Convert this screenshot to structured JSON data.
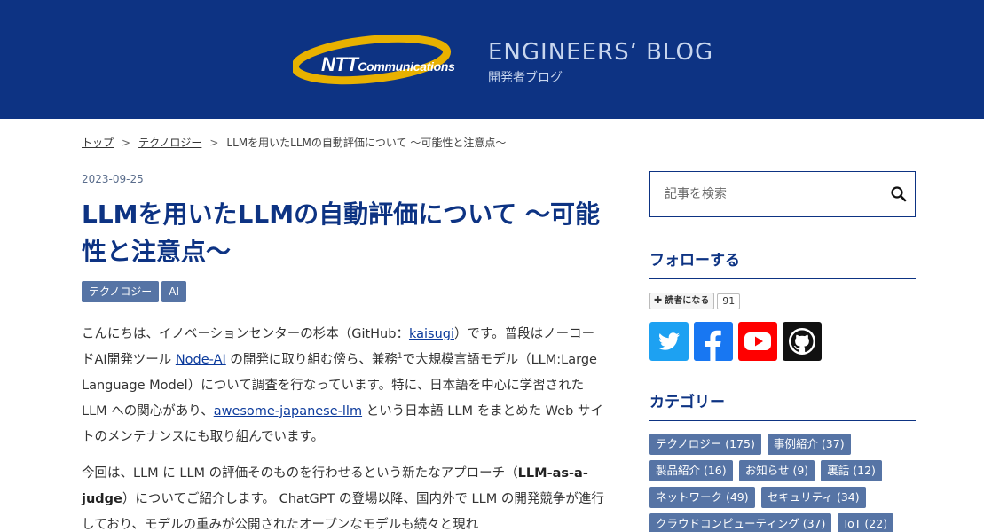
{
  "header": {
    "logo_ntt": "NTT",
    "logo_company": "Communications",
    "blog_title": "ENGINEERS’ BLOG",
    "blog_subtitle": "開発者ブログ"
  },
  "breadcrumb": {
    "items": [
      "トップ",
      "テクノロジー"
    ],
    "separator": ">",
    "current": "LLMを用いたLLMの自動評価について 〜可能性と注意点〜"
  },
  "article": {
    "date": "2023-09-25",
    "title": "LLMを用いたLLMの自動評価について 〜可能性と注意点〜",
    "tags": [
      "テクノロジー",
      "AI"
    ],
    "p1": {
      "t1": "こんにちは、イノベーションセンターの杉本（GitHub：",
      "link1": "kaisugi",
      "t2": "）です。普段はノーコードAI開発ツール ",
      "link2": "Node-AI",
      "t3": " の開発に取り組む傍ら、兼務",
      "sup": "1",
      "t4": "で大規模言語モデル（LLM:Large Language Model）について調査を行なっています。特に、日本語を中心に学習された LLM への関心があり、",
      "link3": "awesome-japanese-llm",
      "t5": " という日本語 LLM をまとめた Web サイトのメンテナンスにも取り組んでいます。"
    },
    "p2": {
      "t1": "今回は、LLM に LLM の評価そのものを行わせるという新たなアプローチ（",
      "bold": "LLM-as-a-judge",
      "t2": "）についてご紹介します。 ChatGPT の登場以降、国内外で LLM の開発競争が進行しており、モデルの重みが公開されたオープンなモデルも続々と現れ"
    }
  },
  "sidebar": {
    "search_placeholder": "記事を検索",
    "follow_heading": "フォローする",
    "reader_button": "読者になる",
    "reader_count": "91",
    "social": [
      "twitter-icon",
      "facebook-icon",
      "youtube-icon",
      "github-icon"
    ],
    "category_heading": "カテゴリー",
    "categories": [
      "テクノロジー (175)",
      "事例紹介 (37)",
      "製品紹介 (16)",
      "お知らせ (9)",
      "裏話 (12)",
      "ネットワーク (49)",
      "セキュリティ (34)",
      "クラウドコンピューティング (37)",
      "IoT (22)"
    ]
  },
  "colors": {
    "header_bg": "#0d3383",
    "accent": "#0d3383",
    "tag_bg": "#5674a5",
    "twitter": "#1da1f2",
    "facebook": "#1877f2",
    "youtube": "#ff0000",
    "github": "#111111"
  }
}
